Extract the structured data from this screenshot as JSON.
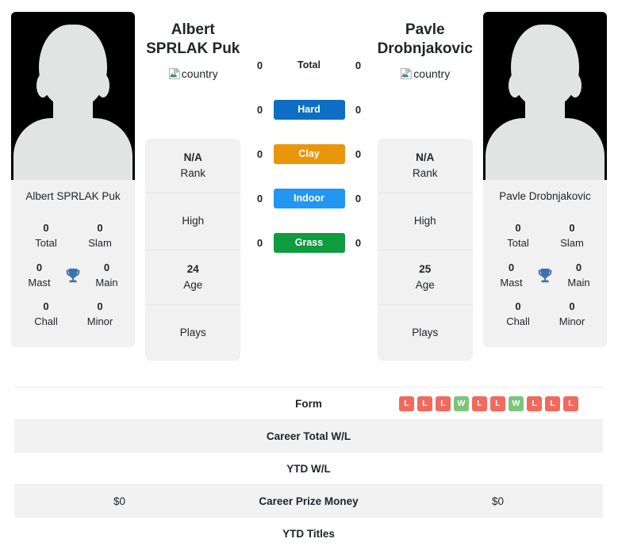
{
  "players": {
    "left": {
      "first_name": "Albert",
      "last_name": "SPRLAK Puk",
      "full_name": "Albert SPRLAK Puk",
      "country_alt": "country",
      "rank_value": "N/A",
      "rank_label": "Rank",
      "high_label": "High",
      "high_value": "",
      "age_value": "24",
      "age_label": "Age",
      "plays_label": "Plays",
      "plays_value": "",
      "titles": {
        "total_value": "0",
        "total_label": "Total",
        "slam_value": "0",
        "slam_label": "Slam",
        "mast_value": "0",
        "mast_label": "Mast",
        "main_value": "0",
        "main_label": "Main",
        "chall_value": "0",
        "chall_label": "Chall",
        "minor_value": "0",
        "minor_label": "Minor"
      }
    },
    "right": {
      "first_name": "Pavle",
      "last_name": "Drobnjakovic",
      "full_name": "Pavle Drobnjakovic",
      "country_alt": "country",
      "rank_value": "N/A",
      "rank_label": "Rank",
      "high_label": "High",
      "high_value": "",
      "age_value": "25",
      "age_label": "Age",
      "plays_label": "Plays",
      "plays_value": "",
      "titles": {
        "total_value": "0",
        "total_label": "Total",
        "slam_value": "0",
        "slam_label": "Slam",
        "mast_value": "0",
        "mast_label": "Mast",
        "main_value": "0",
        "main_label": "Main",
        "chall_value": "0",
        "chall_label": "Chall",
        "minor_value": "0",
        "minor_label": "Minor"
      }
    }
  },
  "surfaces": [
    {
      "label": "Total",
      "left": "0",
      "right": "0",
      "color": "",
      "plain": true
    },
    {
      "label": "Hard",
      "left": "0",
      "right": "0",
      "color": "#0d6ec4",
      "plain": false
    },
    {
      "label": "Clay",
      "left": "0",
      "right": "0",
      "color": "#e8960c",
      "plain": false
    },
    {
      "label": "Indoor",
      "left": "0",
      "right": "0",
      "color": "#2196f3",
      "plain": false
    },
    {
      "label": "Grass",
      "left": "0",
      "right": "0",
      "color": "#0f9b3f",
      "plain": false
    }
  ],
  "table": {
    "rows": [
      {
        "label": "Form",
        "left": "",
        "right": "",
        "type": "form",
        "striped": false
      },
      {
        "label": "Career Total W/L",
        "left": "",
        "right": "",
        "type": "text",
        "striped": true
      },
      {
        "label": "YTD W/L",
        "left": "",
        "right": "",
        "type": "text",
        "striped": false
      },
      {
        "label": "Career Prize Money",
        "left": "$0",
        "right": "$0",
        "type": "text",
        "striped": true
      },
      {
        "label": "YTD Titles",
        "left": "",
        "right": "",
        "type": "text",
        "striped": false
      }
    ],
    "form_right": [
      "L",
      "L",
      "L",
      "W",
      "L",
      "L",
      "W",
      "L",
      "L",
      "L"
    ]
  },
  "colors": {
    "win": "#f2695d",
    "loss": "#f2695d",
    "win_badge": "#7cc47c",
    "loss_badge": "#f2695d",
    "trophy": "#3f72ad",
    "panel": "#f1f1f1",
    "stripe": "#f2f2f2"
  }
}
